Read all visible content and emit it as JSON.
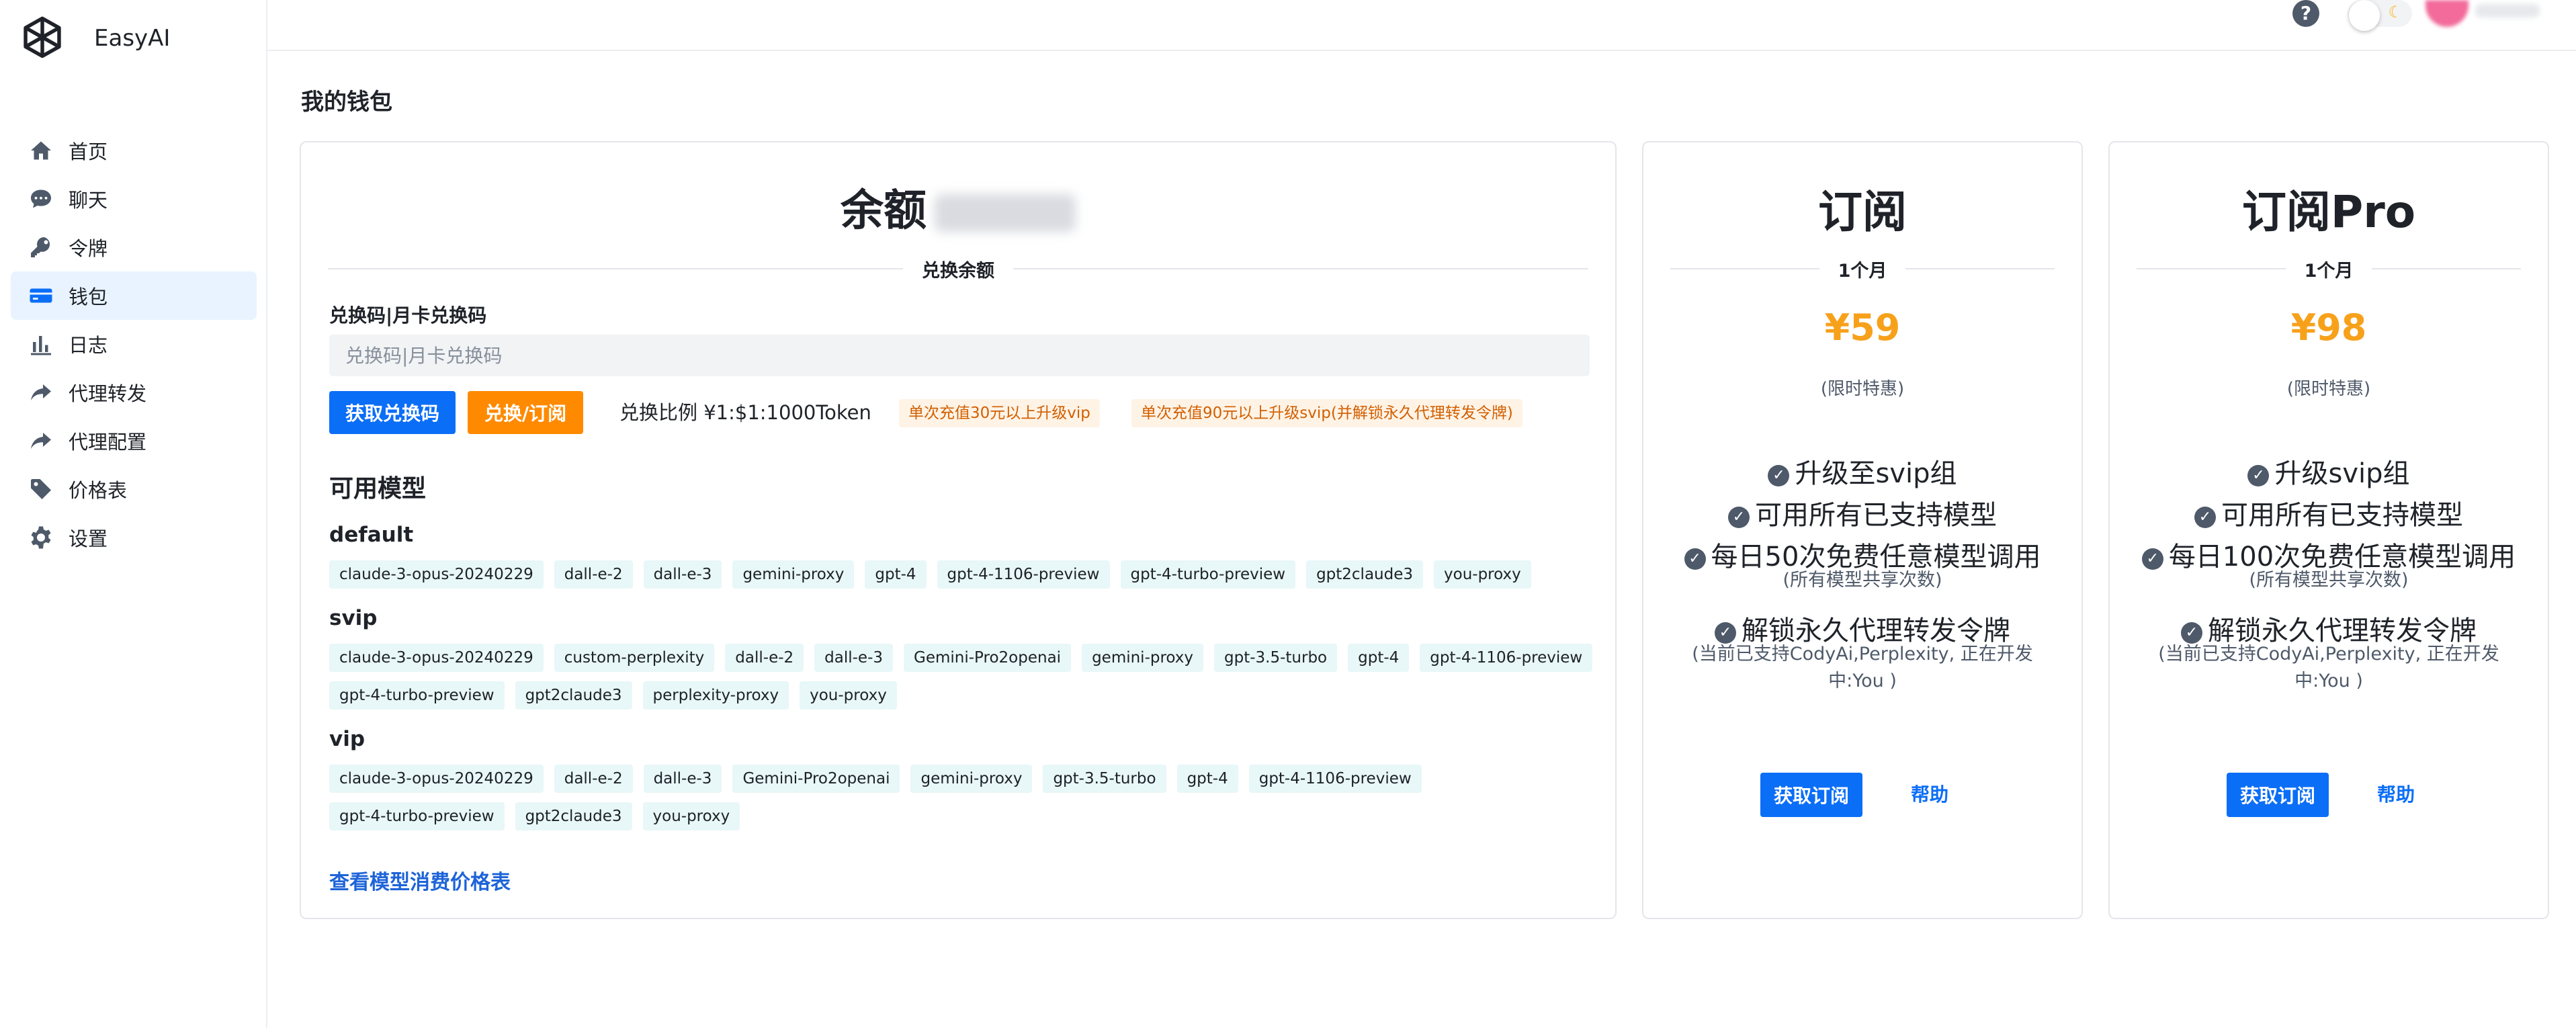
{
  "app": {
    "name": "EasyAI"
  },
  "sidebar": {
    "items": [
      {
        "label": "首页",
        "icon": "home-icon"
      },
      {
        "label": "聊天",
        "icon": "chat-icon"
      },
      {
        "label": "令牌",
        "icon": "key-icon"
      },
      {
        "label": "钱包",
        "icon": "wallet-icon",
        "active": true
      },
      {
        "label": "日志",
        "icon": "bar-chart-icon"
      },
      {
        "label": "代理转发",
        "icon": "share-icon"
      },
      {
        "label": "代理配置",
        "icon": "share-icon"
      },
      {
        "label": "价格表",
        "icon": "tag-icon"
      },
      {
        "label": "设置",
        "icon": "gear-icon"
      }
    ]
  },
  "header": {
    "help_icon": "?",
    "theme_icon": "☾"
  },
  "page": {
    "title": "我的钱包"
  },
  "wallet": {
    "balance_label": "余额",
    "redeem_divider": "兑换余额",
    "redeem_label": "兑换码|月卡兑换码",
    "redeem_placeholder": "兑换码|月卡兑换码",
    "get_code_button": "获取兑换码",
    "redeem_button": "兑换/订阅",
    "ratio_text": "兑换比例 ¥1:$1:1000Token",
    "tag_vip": "单次充值30元以上升级vip",
    "tag_svip": "单次充值90元以上升级svip(并解锁永久代理转发令牌)",
    "models_title": "可用模型",
    "groups": [
      {
        "name": "default",
        "models": [
          "claude-3-opus-20240229",
          "dall-e-2",
          "dall-e-3",
          "gemini-proxy",
          "gpt-4",
          "gpt-4-1106-preview",
          "gpt-4-turbo-preview",
          "gpt2claude3",
          "you-proxy"
        ]
      },
      {
        "name": "svip",
        "models": [
          "claude-3-opus-20240229",
          "custom-perplexity",
          "dall-e-2",
          "dall-e-3",
          "Gemini-Pro2openai",
          "gemini-proxy",
          "gpt-3.5-turbo",
          "gpt-4",
          "gpt-4-1106-preview",
          "gpt-4-turbo-preview",
          "gpt2claude3",
          "perplexity-proxy",
          "you-proxy"
        ]
      },
      {
        "name": "vip",
        "models": [
          "claude-3-opus-20240229",
          "dall-e-2",
          "dall-e-3",
          "Gemini-Pro2openai",
          "gemini-proxy",
          "gpt-3.5-turbo",
          "gpt-4",
          "gpt-4-1106-preview",
          "gpt-4-turbo-preview",
          "gpt2claude3",
          "you-proxy"
        ]
      }
    ],
    "price_link": "查看模型消费价格表"
  },
  "plans": [
    {
      "name": "订阅",
      "period": "1个月",
      "price": "¥59",
      "note": "(限时特惠)",
      "features": [
        "升级至svip组",
        "可用所有已支持模型",
        "每日50次免费任意模型调用",
        "解锁永久代理转发令牌"
      ],
      "feature_notes": [
        "(所有模型共享次数)",
        "(当前已支持CodyAi,Perplexity, 正在开发中:You )"
      ],
      "button": "获取订阅",
      "help": "帮助"
    },
    {
      "name": "订阅Pro",
      "period": "1个月",
      "price": "¥98",
      "note": "(限时特惠)",
      "features": [
        "升级svip组",
        "可用所有已支持模型",
        "每日100次免费任意模型调用",
        "解锁永久代理转发令牌"
      ],
      "feature_notes": [
        "(所有模型共享次数)",
        "(当前已支持CodyAi,Perplexity, 正在开发中:You )"
      ],
      "button": "获取订阅",
      "help": "帮助"
    }
  ],
  "colors": {
    "primary": "#0b6ef7",
    "orange": "#ff8a00",
    "price": "#f7a11b",
    "chip_bg": "#e8f7f7",
    "active_bg": "#e8f3ff"
  }
}
